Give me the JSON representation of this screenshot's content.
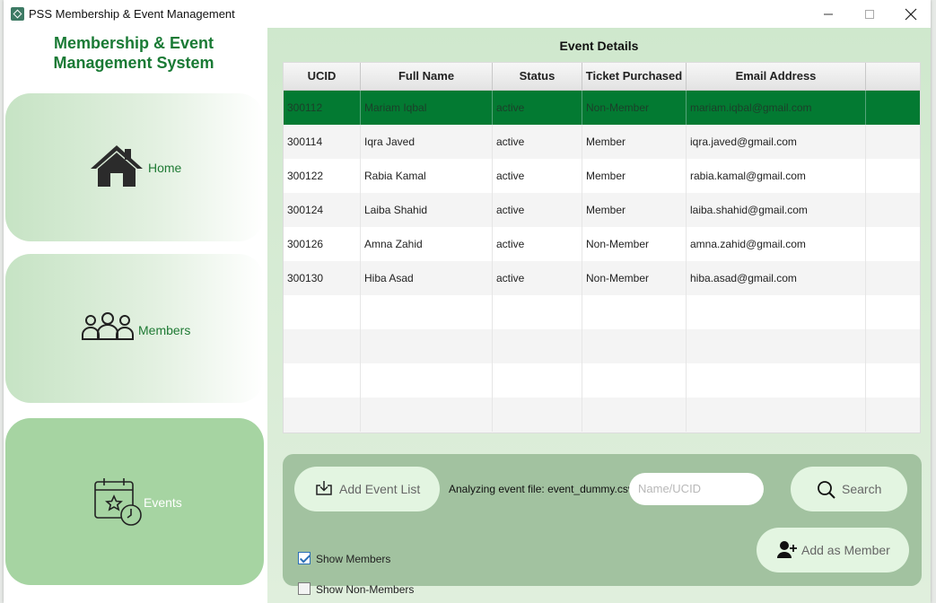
{
  "window": {
    "title": "PSS Membership & Event Management",
    "controls": [
      "minimize-icon",
      "maximize-icon",
      "close-icon"
    ]
  },
  "sidebar": {
    "app_title_line1": "Membership & Event",
    "app_title_line2": "Management System",
    "items": [
      {
        "label": "Home",
        "icon": "home-icon",
        "active": false
      },
      {
        "label": "Members",
        "icon": "members-icon",
        "active": false
      },
      {
        "label": "Events",
        "icon": "calendar-clock-icon",
        "active": true
      }
    ]
  },
  "main": {
    "title": "Event Details",
    "table": {
      "columns": [
        "UCID",
        "Full Name",
        "Status",
        "Ticket Purchased",
        "Email Address"
      ],
      "rows": [
        [
          "300112",
          "Mariam Iqbal",
          "active",
          "Non-Member",
          "mariam.iqbal@gmail.com"
        ],
        [
          "300114",
          "Iqra Javed",
          "active",
          "Member",
          "iqra.javed@gmail.com"
        ],
        [
          "300122",
          "Rabia Kamal",
          "active",
          "Member",
          "rabia.kamal@gmail.com"
        ],
        [
          "300124",
          "Laiba Shahid",
          "active",
          "Member",
          "laiba.shahid@gmail.com"
        ],
        [
          "300126",
          "Amna Zahid",
          "active",
          "Non-Member",
          "amna.zahid@gmail.com"
        ],
        [
          "300130",
          "Hiba Asad",
          "active",
          "Non-Member",
          "hiba.asad@gmail.com"
        ]
      ],
      "selected_row": 0
    },
    "controls": {
      "add_event_list_label": "Add Event List",
      "analyzing_text": "Analyzing event file: event_dummy.csv",
      "search_placeholder": "Name/UCID",
      "search_label": "Search",
      "add_member_label": "Add as Member",
      "show_members_label": "Show Members",
      "show_members_checked": true,
      "show_nonmembers_label": "Show Non-Members",
      "show_nonmembers_checked": false
    }
  },
  "colors": {
    "accent_green": "#1a7a35",
    "selected_row": "#037a32",
    "panel_bg": "#a2c2a0",
    "pill_bg": "#e3f5e1"
  }
}
